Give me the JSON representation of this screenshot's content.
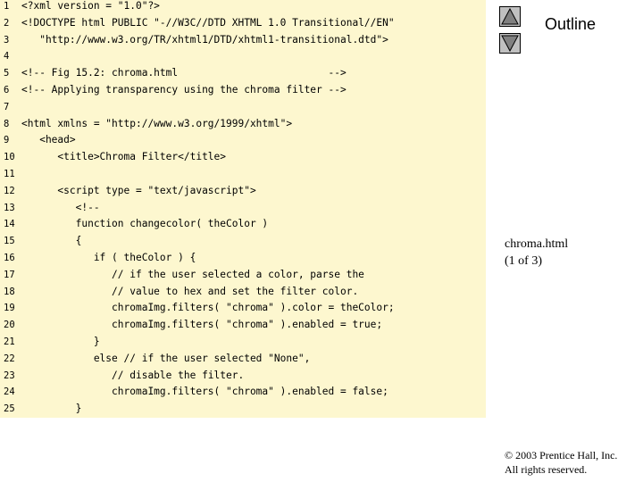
{
  "outline": {
    "title": "Outline"
  },
  "nav": {
    "up_icon": "triangle-up-icon",
    "down_icon": "triangle-down-icon"
  },
  "file": {
    "name": "chroma.html",
    "page": "(1 of 3)"
  },
  "footer": {
    "copyright": "© 2003 Prentice Hall, Inc.",
    "rights": "All rights reserved."
  },
  "code_lines": [
    {
      "n": "1",
      "text": "<?xml version = \"1.0\"?>"
    },
    {
      "n": "2",
      "text": "<!DOCTYPE html PUBLIC \"-//W3C//DTD XHTML 1.0 Transitional//EN\""
    },
    {
      "n": "3",
      "text": "   \"http://www.w3.org/TR/xhtml1/DTD/xhtml1-transitional.dtd\">"
    },
    {
      "n": "4",
      "text": ""
    },
    {
      "n": "5",
      "text": "<!-- Fig 15.2: chroma.html                         -->"
    },
    {
      "n": "6",
      "text": "<!-- Applying transparency using the chroma filter -->"
    },
    {
      "n": "7",
      "text": ""
    },
    {
      "n": "8",
      "text": "<html xmlns = \"http://www.w3.org/1999/xhtml\">"
    },
    {
      "n": "9",
      "text": "   <head>"
    },
    {
      "n": "10",
      "text": "      <title>Chroma Filter</title>"
    },
    {
      "n": "11",
      "text": ""
    },
    {
      "n": "12",
      "text": "      <script type = \"text/javascript\">"
    },
    {
      "n": "13",
      "text": "         <!--"
    },
    {
      "n": "14",
      "text": "         function changecolor( theColor )"
    },
    {
      "n": "15",
      "text": "         {"
    },
    {
      "n": "16",
      "text": "            if ( theColor ) {"
    },
    {
      "n": "17",
      "text": "               // if the user selected a color, parse the"
    },
    {
      "n": "18",
      "text": "               // value to hex and set the filter color."
    },
    {
      "n": "19",
      "text": "               chromaImg.filters( \"chroma\" ).color = theColor;"
    },
    {
      "n": "20",
      "text": "               chromaImg.filters( \"chroma\" ).enabled = true;"
    },
    {
      "n": "21",
      "text": "            }"
    },
    {
      "n": "22",
      "text": "            else // if the user selected \"None\","
    },
    {
      "n": "23",
      "text": "               // disable the filter."
    },
    {
      "n": "24",
      "text": "               chromaImg.filters( \"chroma\" ).enabled = false;"
    },
    {
      "n": "25",
      "text": "         }"
    }
  ]
}
